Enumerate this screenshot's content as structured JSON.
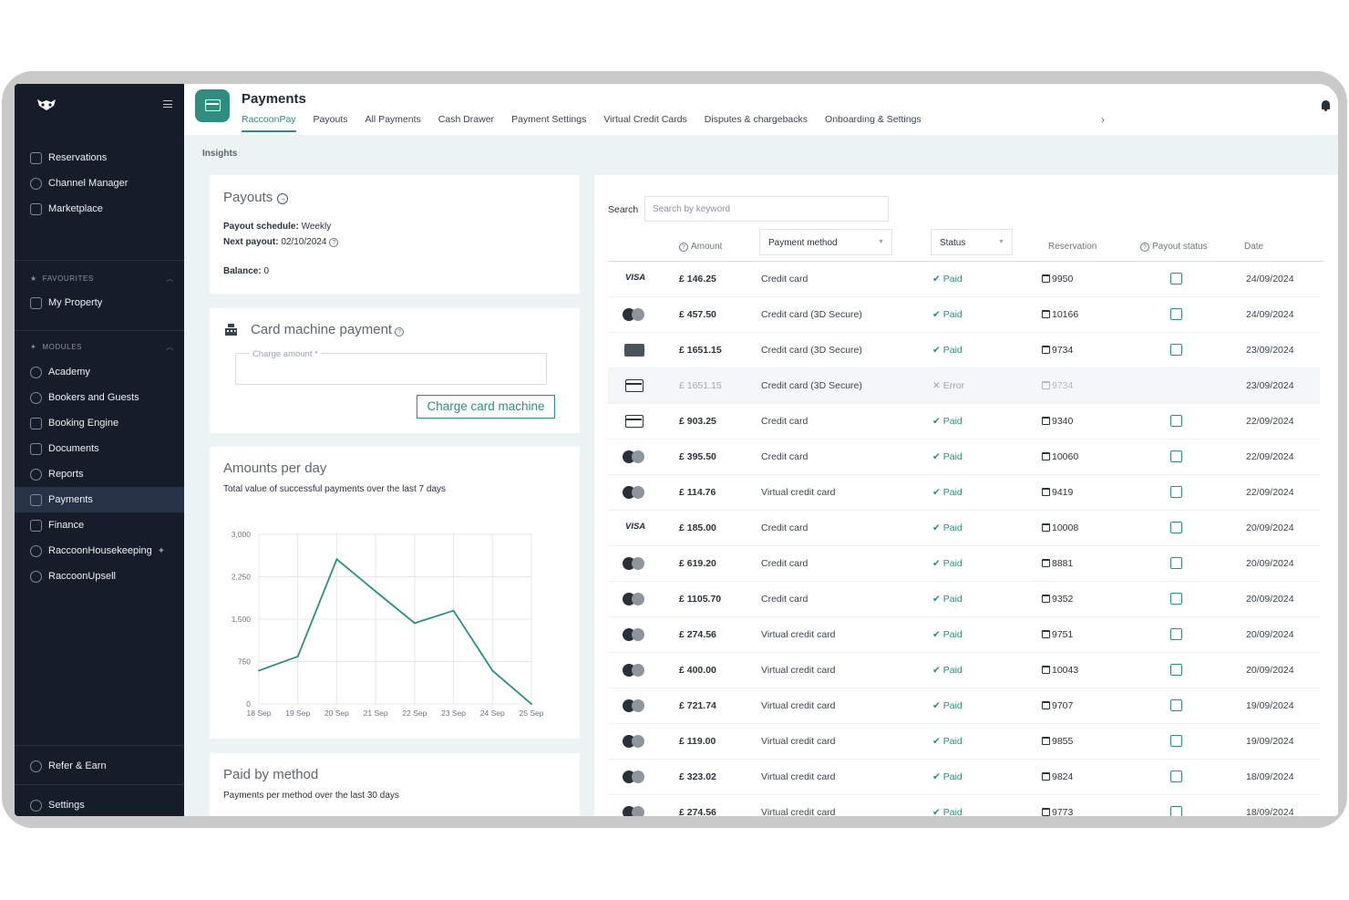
{
  "sidebar": {
    "top_items": [
      {
        "label": "Reservations",
        "icon": "calendar-icon"
      },
      {
        "label": "Channel Manager",
        "icon": "channel-icon"
      },
      {
        "label": "Marketplace",
        "icon": "grid-icon"
      }
    ],
    "favourites_label": "FAVOURITES",
    "favourites": [
      {
        "label": "My Property",
        "icon": "building-icon"
      }
    ],
    "modules_label": "MODULES",
    "modules": [
      {
        "label": "Academy",
        "icon": "academy-icon"
      },
      {
        "label": "Bookers and Guests",
        "icon": "users-icon"
      },
      {
        "label": "Booking Engine",
        "icon": "booking-icon"
      },
      {
        "label": "Documents",
        "icon": "folder-icon"
      },
      {
        "label": "Reports",
        "icon": "reports-icon"
      },
      {
        "label": "Payments",
        "icon": "card-icon",
        "active": true
      },
      {
        "label": "Finance",
        "icon": "finance-icon"
      },
      {
        "label": "RaccoonHousekeeping",
        "icon": "broom-icon"
      },
      {
        "label": "RaccoonUpsell",
        "icon": "plus-circle-icon"
      }
    ],
    "bottom_items": [
      {
        "label": "Refer & Earn",
        "icon": "heart-icon"
      },
      {
        "label": "Settings",
        "icon": "gear-icon"
      }
    ]
  },
  "header": {
    "title": "Payments",
    "tabs": [
      "RaccoonPay",
      "Payouts",
      "All Payments",
      "Cash Drawer",
      "Payment Settings",
      "Virtual Credit Cards",
      "Disputes & chargebacks",
      "Onboarding & Settings"
    ],
    "active_tab": "RaccoonPay"
  },
  "insights_label": "Insights",
  "payouts": {
    "title": "Payouts",
    "schedule_label": "Payout schedule:",
    "schedule_value": "Weekly",
    "next_label": "Next payout:",
    "next_value": "02/10/2024",
    "balance_label": "Balance:",
    "balance_value": "0"
  },
  "card_machine": {
    "title": "Card machine payment",
    "charge_placeholder": "Charge amount *",
    "button": "Charge card machine"
  },
  "amounts_per_day": {
    "title": "Amounts per day",
    "subtitle": "Total value of successful payments over the last 7 days"
  },
  "chart_data": {
    "type": "line",
    "x": [
      "18 Sep",
      "19 Sep",
      "20 Sep",
      "21 Sep",
      "22 Sep",
      "23 Sep",
      "24 Sep",
      "25 Sep"
    ],
    "values": [
      590,
      840,
      2560,
      1990,
      1430,
      1650,
      590,
      0
    ],
    "yticks": [
      "0",
      "750",
      "1,500",
      "2,250",
      "3,000"
    ],
    "ylim": [
      0,
      3000
    ],
    "grid": true,
    "color": "#2f8c7e"
  },
  "paid_by_method": {
    "title": "Paid by method",
    "subtitle": "Payments per method over the last 30 days"
  },
  "table": {
    "search_label": "Search",
    "search_placeholder": "Search by keyword",
    "columns": {
      "amount": "Amount",
      "payment_method": "Payment method",
      "status": "Status",
      "reservation": "Reservation",
      "payout_status": "Payout status",
      "date": "Date"
    },
    "rows": [
      {
        "brand": "visa",
        "amount": "£ 146.25",
        "method": "Credit card",
        "status": "Paid",
        "reservation": "9950",
        "date": "24/09/2024"
      },
      {
        "brand": "mastercard",
        "amount": "£ 457.50",
        "method": "Credit card (3D Secure)",
        "status": "Paid",
        "reservation": "10166",
        "date": "24/09/2024"
      },
      {
        "brand": "amex",
        "amount": "£ 1651.15",
        "method": "Credit card (3D Secure)",
        "status": "Paid",
        "reservation": "9734",
        "date": "23/09/2024"
      },
      {
        "brand": "card",
        "amount": "£ 1651.15",
        "method": "Credit card (3D Secure)",
        "status": "Error",
        "reservation": "9734",
        "date": "23/09/2024",
        "error": true
      },
      {
        "brand": "card",
        "amount": "£ 903.25",
        "method": "Credit card",
        "status": "Paid",
        "reservation": "9340",
        "date": "22/09/2024"
      },
      {
        "brand": "mastercard",
        "amount": "£ 395.50",
        "method": "Credit card",
        "status": "Paid",
        "reservation": "10060",
        "date": "22/09/2024"
      },
      {
        "brand": "mastercard",
        "amount": "£ 114.76",
        "method": "Virtual credit card",
        "status": "Paid",
        "reservation": "9419",
        "date": "22/09/2024"
      },
      {
        "brand": "visa",
        "amount": "£ 185.00",
        "method": "Credit card",
        "status": "Paid",
        "reservation": "10008",
        "date": "20/09/2024"
      },
      {
        "brand": "mastercard",
        "amount": "£ 619.20",
        "method": "Credit card",
        "status": "Paid",
        "reservation": "8881",
        "date": "20/09/2024"
      },
      {
        "brand": "mastercard",
        "amount": "£ 1105.70",
        "method": "Credit card",
        "status": "Paid",
        "reservation": "9352",
        "date": "20/09/2024"
      },
      {
        "brand": "mastercard",
        "amount": "£ 274.56",
        "method": "Virtual credit card",
        "status": "Paid",
        "reservation": "9751",
        "date": "20/09/2024"
      },
      {
        "brand": "mastercard",
        "amount": "£ 400.00",
        "method": "Virtual credit card",
        "status": "Paid",
        "reservation": "10043",
        "date": "20/09/2024"
      },
      {
        "brand": "mastercard",
        "amount": "£ 721.74",
        "method": "Virtual credit card",
        "status": "Paid",
        "reservation": "9707",
        "date": "19/09/2024"
      },
      {
        "brand": "mastercard",
        "amount": "£ 119.00",
        "method": "Virtual credit card",
        "status": "Paid",
        "reservation": "9855",
        "date": "19/09/2024"
      },
      {
        "brand": "mastercard",
        "amount": "£ 323.02",
        "method": "Virtual credit card",
        "status": "Paid",
        "reservation": "9824",
        "date": "18/09/2024"
      },
      {
        "brand": "mastercard",
        "amount": "£ 274.56",
        "method": "Virtual credit card",
        "status": "Paid",
        "reservation": "9773",
        "date": "18/09/2024"
      }
    ]
  },
  "colors": {
    "accent": "#2f8c7e",
    "sidebar": "#151d29",
    "error": "#9aa3ab"
  }
}
